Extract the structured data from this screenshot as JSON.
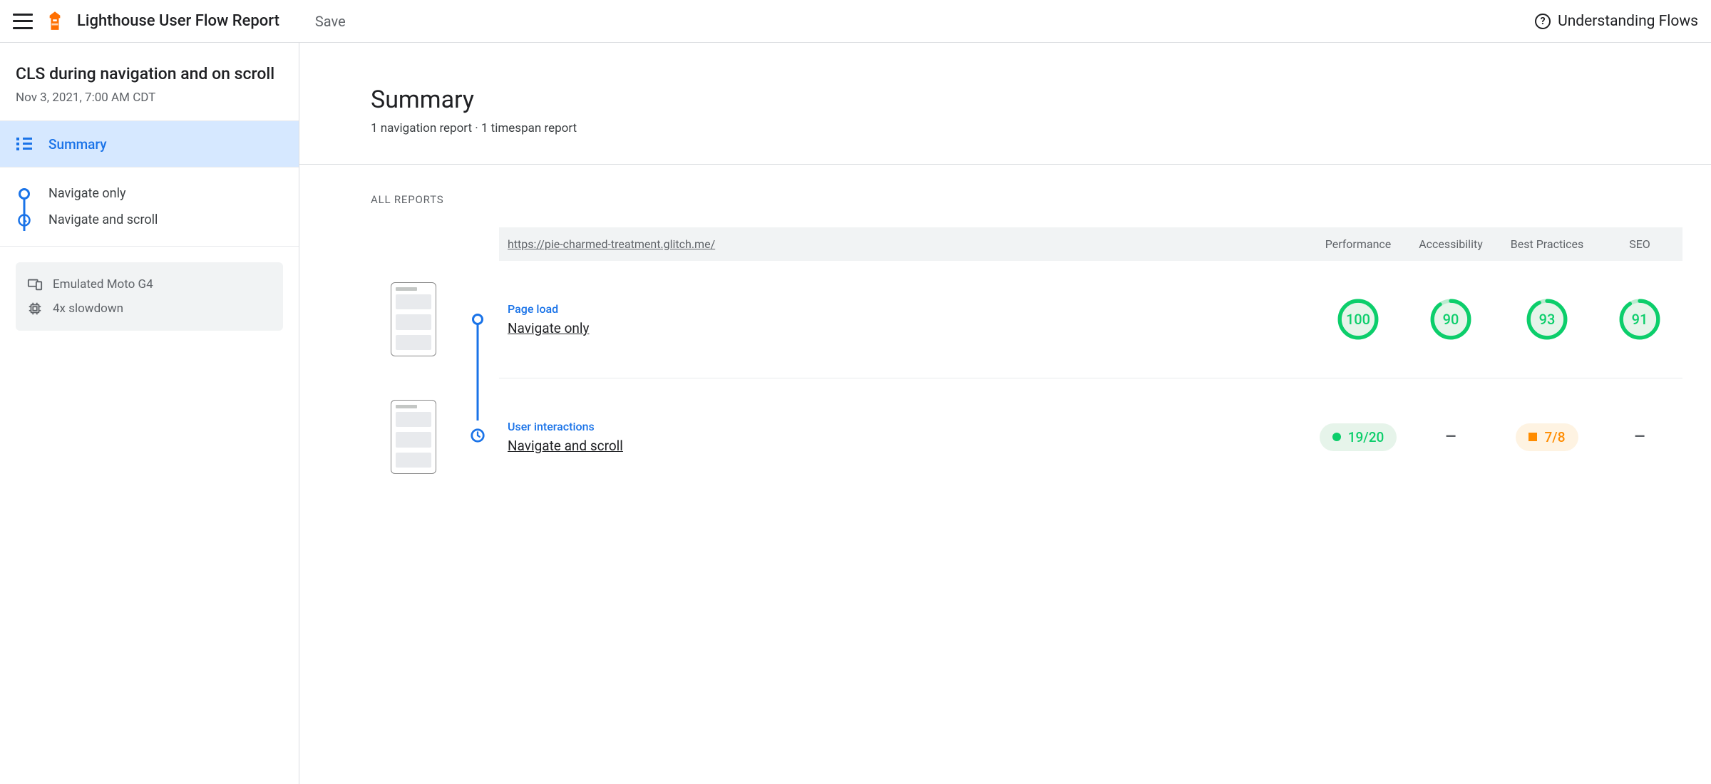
{
  "topbar": {
    "title": "Lighthouse User Flow Report",
    "save": "Save",
    "help": "Understanding Flows"
  },
  "sidebar": {
    "flow_title": "CLS during navigation and on scroll",
    "date": "Nov 3, 2021, 7:00 AM CDT",
    "summary_label": "Summary",
    "steps": [
      {
        "label": "Navigate only",
        "kind": "navigation"
      },
      {
        "label": "Navigate and scroll",
        "kind": "timespan"
      }
    ],
    "meta": {
      "device": "Emulated Moto G4",
      "cpu": "4x slowdown"
    }
  },
  "main": {
    "heading": "Summary",
    "subheading": "1 navigation report · 1 timespan report",
    "all_reports_label": "ALL REPORTS",
    "url": "https://pie-charmed-treatment.glitch.me/",
    "columns": {
      "performance": "Performance",
      "accessibility": "Accessibility",
      "best_practices": "Best Practices",
      "seo": "SEO"
    },
    "rows": [
      {
        "type_label": "Page load",
        "name": "Navigate only",
        "kind": "navigation",
        "scores": {
          "performance": "100",
          "accessibility": "90",
          "best_practices": "93",
          "seo": "91"
        },
        "gauges": {
          "performance": 100,
          "accessibility": 90,
          "best_practices": 93,
          "seo": 91
        }
      },
      {
        "type_label": "User interactions",
        "name": "Navigate and scroll",
        "kind": "timespan",
        "fractions": {
          "performance": "19/20",
          "best_practices": "7/8"
        },
        "accessibility_na": "–",
        "seo_na": "–"
      }
    ]
  }
}
